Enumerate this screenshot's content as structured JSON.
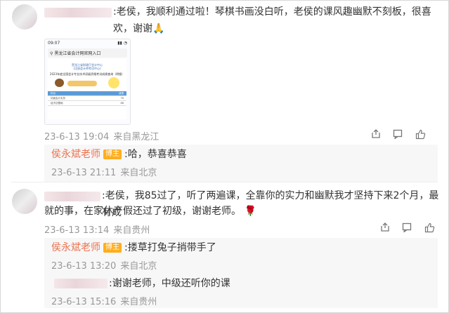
{
  "comments": [
    {
      "text": ":老侯，我顺利通过啦！琴棋书画没白听，老侯的课风趣幽默不刻板，很喜欢，谢谢",
      "emoji": "🙏",
      "time": "23-6-13 19:04",
      "location": "来自黑龙江",
      "likes": "",
      "image": {
        "status_time": "09:07",
        "search": "黑龙江省会计网官网入口",
        "title1": "黑龙江省财政厅会计中心",
        "title2": "(注册会计师考试中心)",
        "table_title": "2023年度全国会计专业技术初级资格考试成绩查询（明细）",
        "rows": [
          {
            "c1": "科目",
            "c2": "成绩"
          },
          {
            "c1": "初级会计实务",
            "c2": "76"
          },
          {
            "c1": "经济法基础",
            "c2": "68"
          }
        ]
      },
      "reply": {
        "author": "侯永斌老师",
        "badge": "博主",
        "text": ":哈，恭喜恭喜",
        "time": "23-6-13 21:11",
        "location": "来自北京"
      }
    },
    {
      "text_line1": ":老侯，我85过了，听了两遍课，全靠你的实力和幽默我才坚持下来2个月，最有成",
      "text_line2": "就的事，在家休产假还过了初级，谢谢老师。",
      "emoji": "🌹",
      "time": "23-6-13 13:14",
      "location": "来自贵州",
      "replies": [
        {
          "author": "侯永斌老师",
          "badge": "博主",
          "text": ":搂草打兔子捎带手了",
          "time": "23-6-13 13:20",
          "location": "来自北京"
        },
        {
          "text": ":谢谢老师，中级还听你的课",
          "time": "23-6-13 15:16",
          "location": "来自贵州"
        }
      ]
    }
  ],
  "icons": [
    "share-icon",
    "comment-icon",
    "like-icon"
  ]
}
